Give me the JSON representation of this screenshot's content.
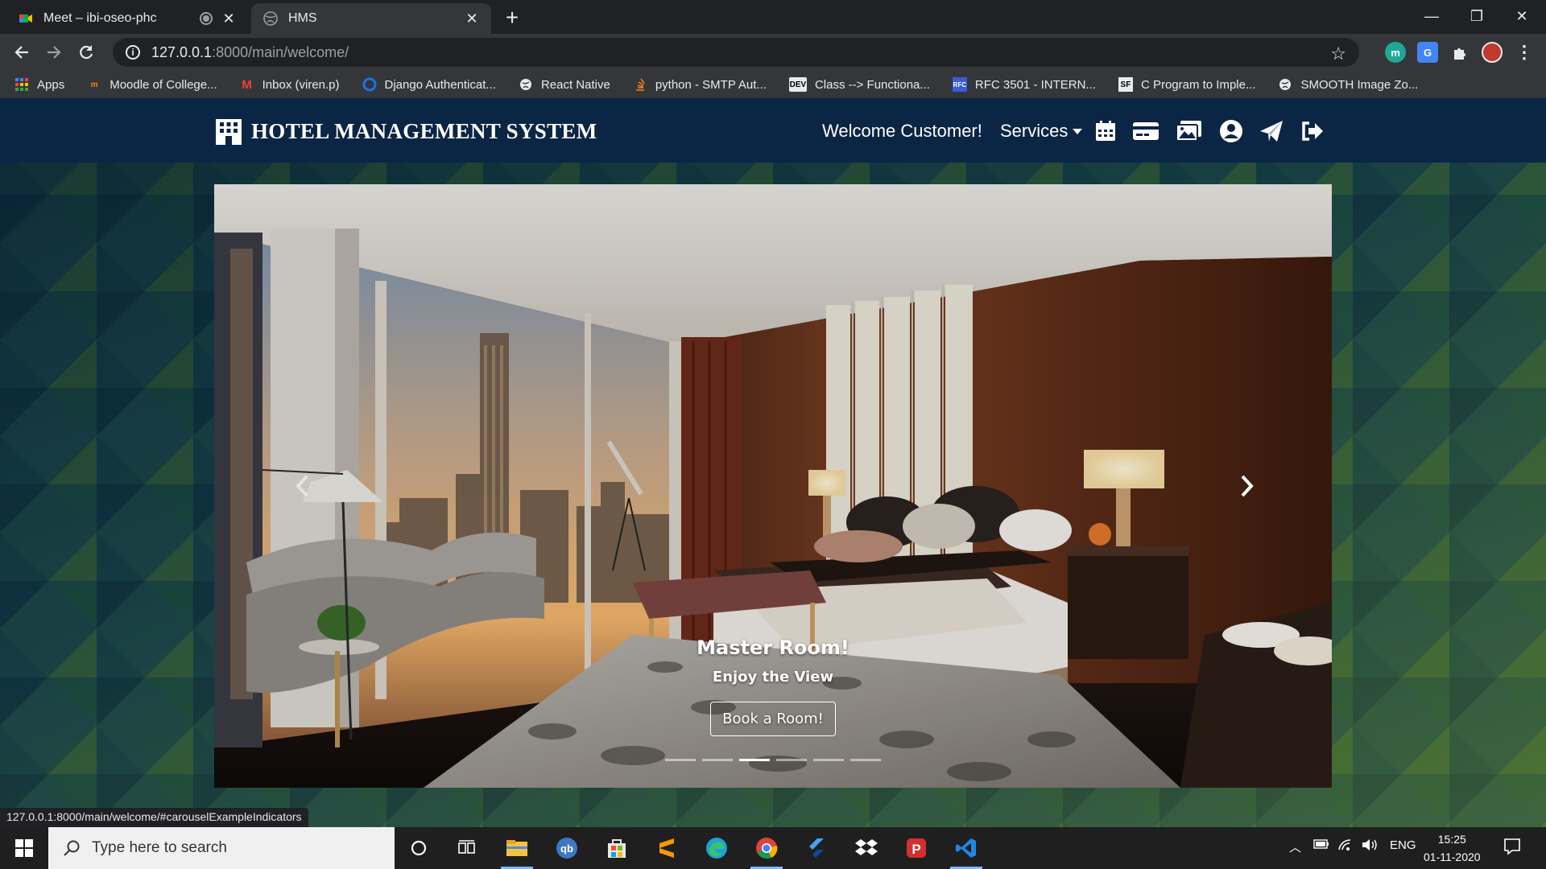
{
  "browser": {
    "tabs": [
      {
        "title": "Meet – ibi-oseo-phc",
        "icon": "google-meet-icon",
        "active": false
      },
      {
        "title": "HMS",
        "icon": "globe-icon",
        "active": true
      }
    ],
    "url_host": "127.0.0.1",
    "url_path": ":8000/main/welcome/",
    "bookmarks": [
      {
        "label": "Apps",
        "icon": "apps-grid-icon"
      },
      {
        "label": "Moodle of College...",
        "icon": "moodle-icon"
      },
      {
        "label": "Inbox (viren.p)",
        "icon": "gmail-icon"
      },
      {
        "label": "Django Authenticat...",
        "icon": "django-icon"
      },
      {
        "label": "React Native",
        "icon": "globe-icon"
      },
      {
        "label": "python - SMTP Aut...",
        "icon": "stackoverflow-icon"
      },
      {
        "label": "Class --> Functiona...",
        "icon": "dev-icon"
      },
      {
        "label": "RFC 3501 - INTERN...",
        "icon": "rfc-icon"
      },
      {
        "label": "C Program to Imple...",
        "icon": "sf-icon"
      },
      {
        "label": "SMOOTH Image Zo...",
        "icon": "globe-icon"
      }
    ],
    "status_url": "127.0.0.1:8000/main/welcome/#carouselExampleIndicators"
  },
  "navbar": {
    "brand": "HOTEL MANAGEMENT SYSTEM",
    "welcome": "Welcome Customer!",
    "services": "Services",
    "icons": [
      "calendar-icon",
      "credit-card-icon",
      "images-icon",
      "user-circle-icon",
      "paper-plane-icon",
      "sign-out-icon"
    ]
  },
  "carousel": {
    "caption_title": "Master Room!",
    "caption_sub": "Enjoy the View",
    "button": "Book a Room!",
    "slide_count": 6,
    "active_index": 2
  },
  "taskbar": {
    "search_placeholder": "Type here to search",
    "language": "ENG",
    "time": "15:25",
    "date": "01-11-2020"
  },
  "colors": {
    "navbar": "#0b2545",
    "browser_dark": "#202124",
    "browser_toolbar": "#35363a"
  }
}
